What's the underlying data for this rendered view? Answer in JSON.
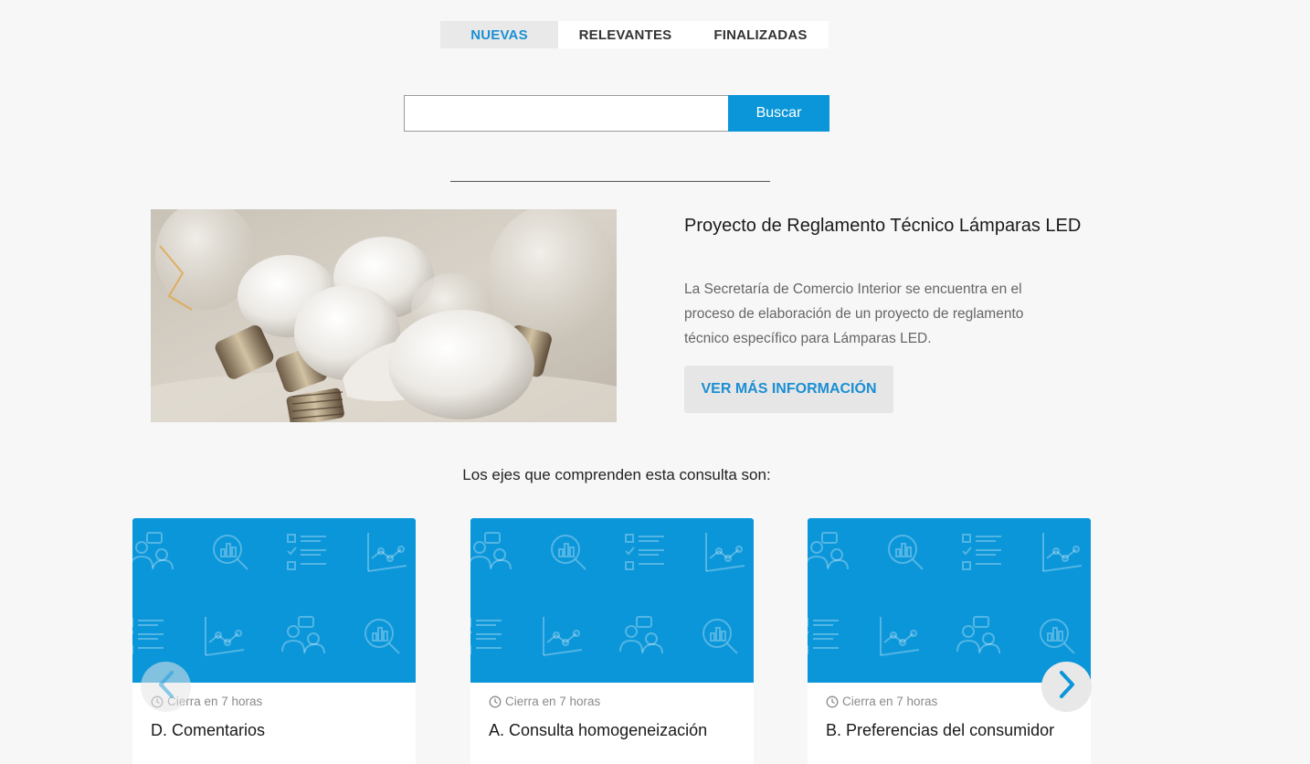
{
  "tabs": [
    {
      "label": "NUEVAS",
      "active": true
    },
    {
      "label": "RELEVANTES",
      "active": false
    },
    {
      "label": "FINALIZADAS",
      "active": false
    }
  ],
  "search": {
    "value": "",
    "placeholder": "",
    "button_label": "Buscar"
  },
  "featured": {
    "image": "led-bulbs-photo",
    "title": "Proyecto de Reglamento Técnico Lámparas LED",
    "description": "La Secretaría de Comercio Interior se encuentra en el proceso de elaboración de un proyecto de reglamento técnico específico para Lámparas LED.",
    "button_label": "VER MÁS INFORMACIÓN"
  },
  "ejes_heading": "Los ejes que comprenden esta consulta son:",
  "cards": [
    {
      "closing": "Cierra en 7 horas",
      "title": "D. Comentarios"
    },
    {
      "closing": "Cierra en 7 horas",
      "title": "A. Consulta homogeneización"
    },
    {
      "closing": "Cierra en 7 horas",
      "title": "B. Preferencias del consumidor"
    }
  ],
  "carousel": {
    "prev_icon": "chevron-left-icon",
    "next_icon": "chevron-right-icon"
  },
  "colors": {
    "accent": "#0a96d9",
    "link": "#1b8fd3",
    "background": "#f7f7f7"
  }
}
